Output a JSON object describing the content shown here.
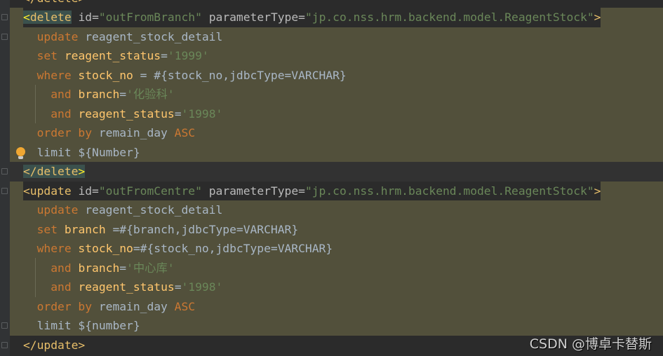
{
  "editor": {
    "lines": [
      {
        "bg": "dark",
        "tokens": [
          {
            "t": "</delete>",
            "c": "tag"
          }
        ]
      },
      {
        "bg": "tagline",
        "tokens": [
          {
            "t": "<",
            "c": "brh hl"
          },
          {
            "t": "delete",
            "c": "tag hl"
          },
          {
            "t": " ",
            "c": ""
          },
          {
            "t": "id",
            "c": "attr"
          },
          {
            "t": "=",
            "c": "attr"
          },
          {
            "t": "\"outFromBranch\"",
            "c": "val"
          },
          {
            "t": " parameterType",
            "c": "attr"
          },
          {
            "t": "=",
            "c": "attr"
          },
          {
            "t": "\"jp.co.nss.hrm.backend.model.ReagentStock\"",
            "c": "val"
          },
          {
            "t": ">",
            "c": "tag"
          }
        ]
      },
      {
        "bg": "olive",
        "tokens": [
          {
            "t": "  ",
            "c": ""
          },
          {
            "t": "update",
            "c": "kw"
          },
          {
            "t": " reagent_stock_detail",
            "c": "sql"
          }
        ]
      },
      {
        "bg": "olive",
        "tokens": [
          {
            "t": "  ",
            "c": ""
          },
          {
            "t": "set",
            "c": "kw"
          },
          {
            "t": " reagent_status",
            "c": "col"
          },
          {
            "t": "=",
            "c": "sql"
          },
          {
            "t": "'1999'",
            "c": "str"
          }
        ]
      },
      {
        "bg": "olive",
        "tokens": [
          {
            "t": "  ",
            "c": ""
          },
          {
            "t": "where",
            "c": "kw"
          },
          {
            "t": " stock_no",
            "c": "col"
          },
          {
            "t": " = #{stock_no,jdbcType=VARCHAR}",
            "c": "sql"
          }
        ]
      },
      {
        "bg": "olive",
        "tokens": [
          {
            "t": "    ",
            "c": ""
          },
          {
            "t": "and",
            "c": "kw"
          },
          {
            "t": " branch",
            "c": "col"
          },
          {
            "t": "=",
            "c": "sql"
          },
          {
            "t": "'化验科'",
            "c": "str"
          }
        ]
      },
      {
        "bg": "olive",
        "tokens": [
          {
            "t": "    ",
            "c": ""
          },
          {
            "t": "and",
            "c": "kw"
          },
          {
            "t": " reagent_status",
            "c": "col"
          },
          {
            "t": "=",
            "c": "sql"
          },
          {
            "t": "'1998'",
            "c": "str"
          }
        ]
      },
      {
        "bg": "olive",
        "tokens": [
          {
            "t": "  ",
            "c": ""
          },
          {
            "t": "order by",
            "c": "kw"
          },
          {
            "t": " remain_day ",
            "c": "sql"
          },
          {
            "t": "ASC",
            "c": "kw"
          }
        ]
      },
      {
        "bg": "olive",
        "tokens": [
          {
            "t": "  ",
            "c": ""
          },
          {
            "t": "limit",
            "c": "kw sql"
          },
          {
            "t": " ${Number}",
            "c": "sql"
          }
        ]
      },
      {
        "bg": "cur",
        "tokens": [
          {
            "t": "</delete",
            "c": "tag hl"
          },
          {
            "t": ">",
            "c": "brh hl"
          }
        ]
      },
      {
        "bg": "tagline",
        "tokens": [
          {
            "t": "<update",
            "c": "tag"
          },
          {
            "t": " ",
            "c": ""
          },
          {
            "t": "id",
            "c": "attr"
          },
          {
            "t": "=",
            "c": "attr"
          },
          {
            "t": "\"outFromCentre\"",
            "c": "val"
          },
          {
            "t": " parameterType",
            "c": "attr"
          },
          {
            "t": "=",
            "c": "attr"
          },
          {
            "t": "\"jp.co.nss.hrm.backend.model.ReagentStock\"",
            "c": "val"
          },
          {
            "t": ">",
            "c": "tag"
          }
        ]
      },
      {
        "bg": "olive",
        "tokens": [
          {
            "t": "  ",
            "c": ""
          },
          {
            "t": "update",
            "c": "kw"
          },
          {
            "t": " reagent_stock_detail",
            "c": "sql"
          }
        ]
      },
      {
        "bg": "olive",
        "tokens": [
          {
            "t": "  ",
            "c": ""
          },
          {
            "t": "set",
            "c": "kw"
          },
          {
            "t": " branch",
            "c": "col"
          },
          {
            "t": " =#{branch,jdbcType=VARCHAR}",
            "c": "sql"
          }
        ]
      },
      {
        "bg": "olive",
        "tokens": [
          {
            "t": "  ",
            "c": ""
          },
          {
            "t": "where",
            "c": "kw"
          },
          {
            "t": " stock_no",
            "c": "col"
          },
          {
            "t": "=#{stock_no,jdbcType=VARCHAR}",
            "c": "sql"
          }
        ]
      },
      {
        "bg": "olive",
        "tokens": [
          {
            "t": "    ",
            "c": ""
          },
          {
            "t": "and",
            "c": "kw"
          },
          {
            "t": " branch",
            "c": "col"
          },
          {
            "t": "=",
            "c": "sql"
          },
          {
            "t": "'中心库'",
            "c": "str"
          }
        ]
      },
      {
        "bg": "olive",
        "tokens": [
          {
            "t": "    ",
            "c": ""
          },
          {
            "t": "and",
            "c": "kw"
          },
          {
            "t": " reagent_status",
            "c": "col"
          },
          {
            "t": "=",
            "c": "sql"
          },
          {
            "t": "'1998'",
            "c": "str"
          }
        ]
      },
      {
        "bg": "olive",
        "tokens": [
          {
            "t": "  ",
            "c": ""
          },
          {
            "t": "order by",
            "c": "kw"
          },
          {
            "t": " remain_day ",
            "c": "sql"
          },
          {
            "t": "ASC",
            "c": "kw"
          }
        ]
      },
      {
        "bg": "olive",
        "tokens": [
          {
            "t": "  ",
            "c": ""
          },
          {
            "t": "limit",
            "c": "sql"
          },
          {
            "t": " ${number}",
            "c": "sql"
          }
        ]
      },
      {
        "bg": "dark",
        "tokens": [
          {
            "t": "</update>",
            "c": "tag"
          }
        ]
      }
    ]
  },
  "watermark": "CSDN @博卓卡替斯",
  "colors": {
    "background": "#2b2b2b",
    "highlight": "#52503b",
    "tag": "#e8bf6a",
    "keyword": "#cc7832",
    "string": "#6a8759",
    "column": "#ffc66d",
    "text": "#a9b7c6"
  },
  "icons": {
    "gutter_bulb": "lightbulb-icon",
    "fold": "fold-marker-icon"
  }
}
